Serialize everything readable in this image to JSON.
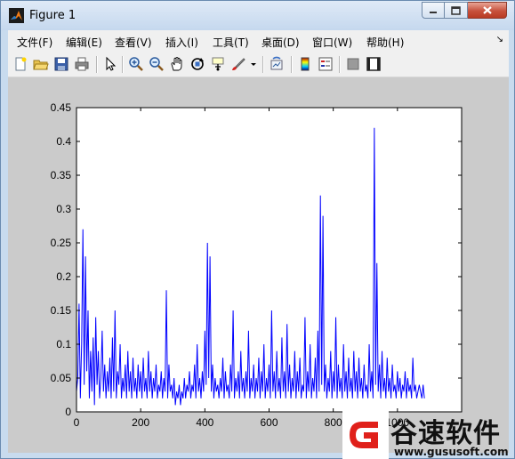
{
  "window": {
    "title": "Figure 1"
  },
  "menu": [
    "文件(F)",
    "编辑(E)",
    "查看(V)",
    "插入(I)",
    "工具(T)",
    "桌面(D)",
    "窗口(W)",
    "帮助(H)"
  ],
  "toolbar": {
    "buttons": [
      "new-figure-icon",
      "open-file-icon",
      "save-icon",
      "print-icon",
      "edit-plot-arrow-icon",
      "zoom-in-icon",
      "zoom-out-icon",
      "pan-hand-icon",
      "rotate-3d-icon",
      "data-cursor-icon",
      "brush-icon",
      "link-plot-icon",
      "insert-colorbar-icon",
      "insert-legend-icon",
      "hide-plot-tools-icon",
      "show-plot-tools-icon"
    ]
  },
  "watermark": {
    "name": "谷速软件",
    "url": "www.gususoft.com"
  },
  "colors": {
    "line": "#0000ff",
    "figure_bg": "#cbcbcb",
    "axes_bg": "#ffffff"
  },
  "chart_data": {
    "type": "line",
    "title": "",
    "xlabel": "",
    "ylabel": "",
    "xlim": [
      0,
      1200
    ],
    "ylim": [
      0,
      0.45
    ],
    "xticks": [
      0,
      200,
      400,
      600,
      800,
      1000
    ],
    "yticks": [
      0,
      0.05,
      0.1,
      0.15,
      0.2,
      0.25,
      0.3,
      0.35,
      0.4,
      0.45
    ],
    "xtick_labels": [
      "0",
      "200",
      "400",
      "600",
      "800",
      "1000"
    ],
    "ytick_labels": [
      "0",
      "0.05",
      "0.1",
      "0.15",
      "0.2",
      "0.25",
      "0.3",
      "0.35",
      "0.4",
      "0.45"
    ],
    "grid": false,
    "series": [
      {
        "color": "#0000ff",
        "points": [
          [
            0,
            0.03
          ],
          [
            4,
            0.05
          ],
          [
            8,
            0.16
          ],
          [
            12,
            0.02
          ],
          [
            16,
            0.1
          ],
          [
            20,
            0.27
          ],
          [
            24,
            0.04
          ],
          [
            28,
            0.23
          ],
          [
            32,
            0.06
          ],
          [
            36,
            0.15
          ],
          [
            40,
            0.02
          ],
          [
            44,
            0.09
          ],
          [
            48,
            0.03
          ],
          [
            52,
            0.11
          ],
          [
            56,
            0.01
          ],
          [
            60,
            0.14
          ],
          [
            64,
            0.04
          ],
          [
            68,
            0.09
          ],
          [
            72,
            0.02
          ],
          [
            76,
            0.05
          ],
          [
            80,
            0.12
          ],
          [
            84,
            0.03
          ],
          [
            88,
            0.07
          ],
          [
            92,
            0.02
          ],
          [
            96,
            0.06
          ],
          [
            100,
            0.03
          ],
          [
            104,
            0.08
          ],
          [
            108,
            0.02
          ],
          [
            112,
            0.11
          ],
          [
            116,
            0.03
          ],
          [
            120,
            0.15
          ],
          [
            124,
            0.02
          ],
          [
            128,
            0.06
          ],
          [
            132,
            0.04
          ],
          [
            136,
            0.1
          ],
          [
            140,
            0.02
          ],
          [
            144,
            0.05
          ],
          [
            148,
            0.03
          ],
          [
            152,
            0.07
          ],
          [
            156,
            0.02
          ],
          [
            160,
            0.09
          ],
          [
            164,
            0.03
          ],
          [
            168,
            0.06
          ],
          [
            172,
            0.02
          ],
          [
            176,
            0.08
          ],
          [
            180,
            0.03
          ],
          [
            184,
            0.05
          ],
          [
            188,
            0.02
          ],
          [
            192,
            0.07
          ],
          [
            196,
            0.03
          ],
          [
            200,
            0.06
          ],
          [
            204,
            0.02
          ],
          [
            208,
            0.08
          ],
          [
            212,
            0.03
          ],
          [
            216,
            0.05
          ],
          [
            220,
            0.02
          ],
          [
            224,
            0.09
          ],
          [
            228,
            0.03
          ],
          [
            232,
            0.06
          ],
          [
            236,
            0.02
          ],
          [
            240,
            0.05
          ],
          [
            244,
            0.03
          ],
          [
            248,
            0.07
          ],
          [
            252,
            0.02
          ],
          [
            256,
            0.04
          ],
          [
            260,
            0.03
          ],
          [
            264,
            0.06
          ],
          [
            268,
            0.02
          ],
          [
            272,
            0.05
          ],
          [
            276,
            0.03
          ],
          [
            280,
            0.18
          ],
          [
            284,
            0.02
          ],
          [
            288,
            0.07
          ],
          [
            292,
            0.03
          ],
          [
            296,
            0.04
          ],
          [
            300,
            0.02
          ],
          [
            304,
            0.05
          ],
          [
            308,
            0.01
          ],
          [
            312,
            0.03
          ],
          [
            316,
            0.02
          ],
          [
            320,
            0.04
          ],
          [
            324,
            0.01
          ],
          [
            328,
            0.03
          ],
          [
            332,
            0.02
          ],
          [
            336,
            0.05
          ],
          [
            340,
            0.02
          ],
          [
            344,
            0.04
          ],
          [
            348,
            0.03
          ],
          [
            352,
            0.06
          ],
          [
            356,
            0.02
          ],
          [
            360,
            0.04
          ],
          [
            364,
            0.03
          ],
          [
            368,
            0.07
          ],
          [
            372,
            0.02
          ],
          [
            376,
            0.1
          ],
          [
            380,
            0.03
          ],
          [
            384,
            0.05
          ],
          [
            388,
            0.02
          ],
          [
            392,
            0.06
          ],
          [
            396,
            0.03
          ],
          [
            400,
            0.12
          ],
          [
            404,
            0.04
          ],
          [
            408,
            0.25
          ],
          [
            412,
            0.05
          ],
          [
            416,
            0.23
          ],
          [
            420,
            0.03
          ],
          [
            424,
            0.07
          ],
          [
            428,
            0.02
          ],
          [
            432,
            0.05
          ],
          [
            436,
            0.03
          ],
          [
            440,
            0.04
          ],
          [
            444,
            0.02
          ],
          [
            448,
            0.05
          ],
          [
            452,
            0.03
          ],
          [
            456,
            0.08
          ],
          [
            460,
            0.02
          ],
          [
            464,
            0.06
          ],
          [
            468,
            0.03
          ],
          [
            472,
            0.04
          ],
          [
            476,
            0.02
          ],
          [
            480,
            0.07
          ],
          [
            484,
            0.03
          ],
          [
            488,
            0.15
          ],
          [
            492,
            0.02
          ],
          [
            496,
            0.05
          ],
          [
            500,
            0.03
          ],
          [
            504,
            0.06
          ],
          [
            508,
            0.02
          ],
          [
            512,
            0.09
          ],
          [
            516,
            0.03
          ],
          [
            520,
            0.05
          ],
          [
            524,
            0.02
          ],
          [
            528,
            0.06
          ],
          [
            532,
            0.03
          ],
          [
            536,
            0.12
          ],
          [
            540,
            0.02
          ],
          [
            544,
            0.05
          ],
          [
            548,
            0.03
          ],
          [
            552,
            0.07
          ],
          [
            556,
            0.02
          ],
          [
            560,
            0.05
          ],
          [
            564,
            0.03
          ],
          [
            568,
            0.08
          ],
          [
            572,
            0.02
          ],
          [
            576,
            0.06
          ],
          [
            580,
            0.03
          ],
          [
            584,
            0.1
          ],
          [
            588,
            0.02
          ],
          [
            592,
            0.05
          ],
          [
            596,
            0.03
          ],
          [
            600,
            0.07
          ],
          [
            604,
            0.02
          ],
          [
            608,
            0.15
          ],
          [
            612,
            0.03
          ],
          [
            616,
            0.06
          ],
          [
            620,
            0.02
          ],
          [
            624,
            0.09
          ],
          [
            628,
            0.03
          ],
          [
            632,
            0.05
          ],
          [
            636,
            0.02
          ],
          [
            640,
            0.11
          ],
          [
            644,
            0.03
          ],
          [
            648,
            0.06
          ],
          [
            652,
            0.02
          ],
          [
            656,
            0.13
          ],
          [
            660,
            0.03
          ],
          [
            664,
            0.07
          ],
          [
            668,
            0.02
          ],
          [
            672,
            0.05
          ],
          [
            676,
            0.03
          ],
          [
            680,
            0.09
          ],
          [
            684,
            0.02
          ],
          [
            688,
            0.06
          ],
          [
            692,
            0.03
          ],
          [
            696,
            0.08
          ],
          [
            700,
            0.02
          ],
          [
            704,
            0.04
          ],
          [
            708,
            0.03
          ],
          [
            712,
            0.14
          ],
          [
            716,
            0.02
          ],
          [
            720,
            0.06
          ],
          [
            724,
            0.03
          ],
          [
            728,
            0.1
          ],
          [
            732,
            0.02
          ],
          [
            736,
            0.05
          ],
          [
            740,
            0.03
          ],
          [
            744,
            0.08
          ],
          [
            748,
            0.02
          ],
          [
            752,
            0.12
          ],
          [
            756,
            0.03
          ],
          [
            760,
            0.32
          ],
          [
            764,
            0.04
          ],
          [
            768,
            0.29
          ],
          [
            772,
            0.03
          ],
          [
            776,
            0.07
          ],
          [
            780,
            0.02
          ],
          [
            784,
            0.05
          ],
          [
            788,
            0.03
          ],
          [
            792,
            0.09
          ],
          [
            796,
            0.02
          ],
          [
            800,
            0.06
          ],
          [
            804,
            0.03
          ],
          [
            808,
            0.14
          ],
          [
            812,
            0.02
          ],
          [
            816,
            0.07
          ],
          [
            820,
            0.03
          ],
          [
            824,
            0.05
          ],
          [
            828,
            0.02
          ],
          [
            832,
            0.1
          ],
          [
            836,
            0.03
          ],
          [
            840,
            0.06
          ],
          [
            844,
            0.02
          ],
          [
            848,
            0.08
          ],
          [
            852,
            0.03
          ],
          [
            856,
            0.05
          ],
          [
            860,
            0.02
          ],
          [
            864,
            0.09
          ],
          [
            868,
            0.03
          ],
          [
            872,
            0.06
          ],
          [
            876,
            0.02
          ],
          [
            880,
            0.08
          ],
          [
            884,
            0.03
          ],
          [
            888,
            0.05
          ],
          [
            892,
            0.02
          ],
          [
            896,
            0.07
          ],
          [
            900,
            0.03
          ],
          [
            904,
            0.04
          ],
          [
            908,
            0.02
          ],
          [
            912,
            0.1
          ],
          [
            916,
            0.03
          ],
          [
            920,
            0.06
          ],
          [
            924,
            0.02
          ],
          [
            928,
            0.42
          ],
          [
            932,
            0.04
          ],
          [
            936,
            0.22
          ],
          [
            940,
            0.03
          ],
          [
            944,
            0.07
          ],
          [
            948,
            0.02
          ],
          [
            952,
            0.09
          ],
          [
            956,
            0.03
          ],
          [
            960,
            0.05
          ],
          [
            964,
            0.02
          ],
          [
            968,
            0.08
          ],
          [
            972,
            0.03
          ],
          [
            976,
            0.05
          ],
          [
            980,
            0.02
          ],
          [
            984,
            0.07
          ],
          [
            988,
            0.03
          ],
          [
            992,
            0.04
          ],
          [
            996,
            0.02
          ],
          [
            1000,
            0.06
          ],
          [
            1004,
            0.03
          ],
          [
            1008,
            0.05
          ],
          [
            1012,
            0.02
          ],
          [
            1016,
            0.04
          ],
          [
            1020,
            0.03
          ],
          [
            1024,
            0.06
          ],
          [
            1028,
            0.02
          ],
          [
            1032,
            0.05
          ],
          [
            1036,
            0.03
          ],
          [
            1040,
            0.04
          ],
          [
            1044,
            0.02
          ],
          [
            1048,
            0.08
          ],
          [
            1052,
            0.03
          ],
          [
            1056,
            0.04
          ],
          [
            1060,
            0.02
          ],
          [
            1064,
            0.03
          ],
          [
            1068,
            0.04
          ],
          [
            1072,
            0.03
          ],
          [
            1076,
            0.02
          ],
          [
            1080,
            0.04
          ],
          [
            1084,
            0.02
          ]
        ]
      }
    ]
  }
}
